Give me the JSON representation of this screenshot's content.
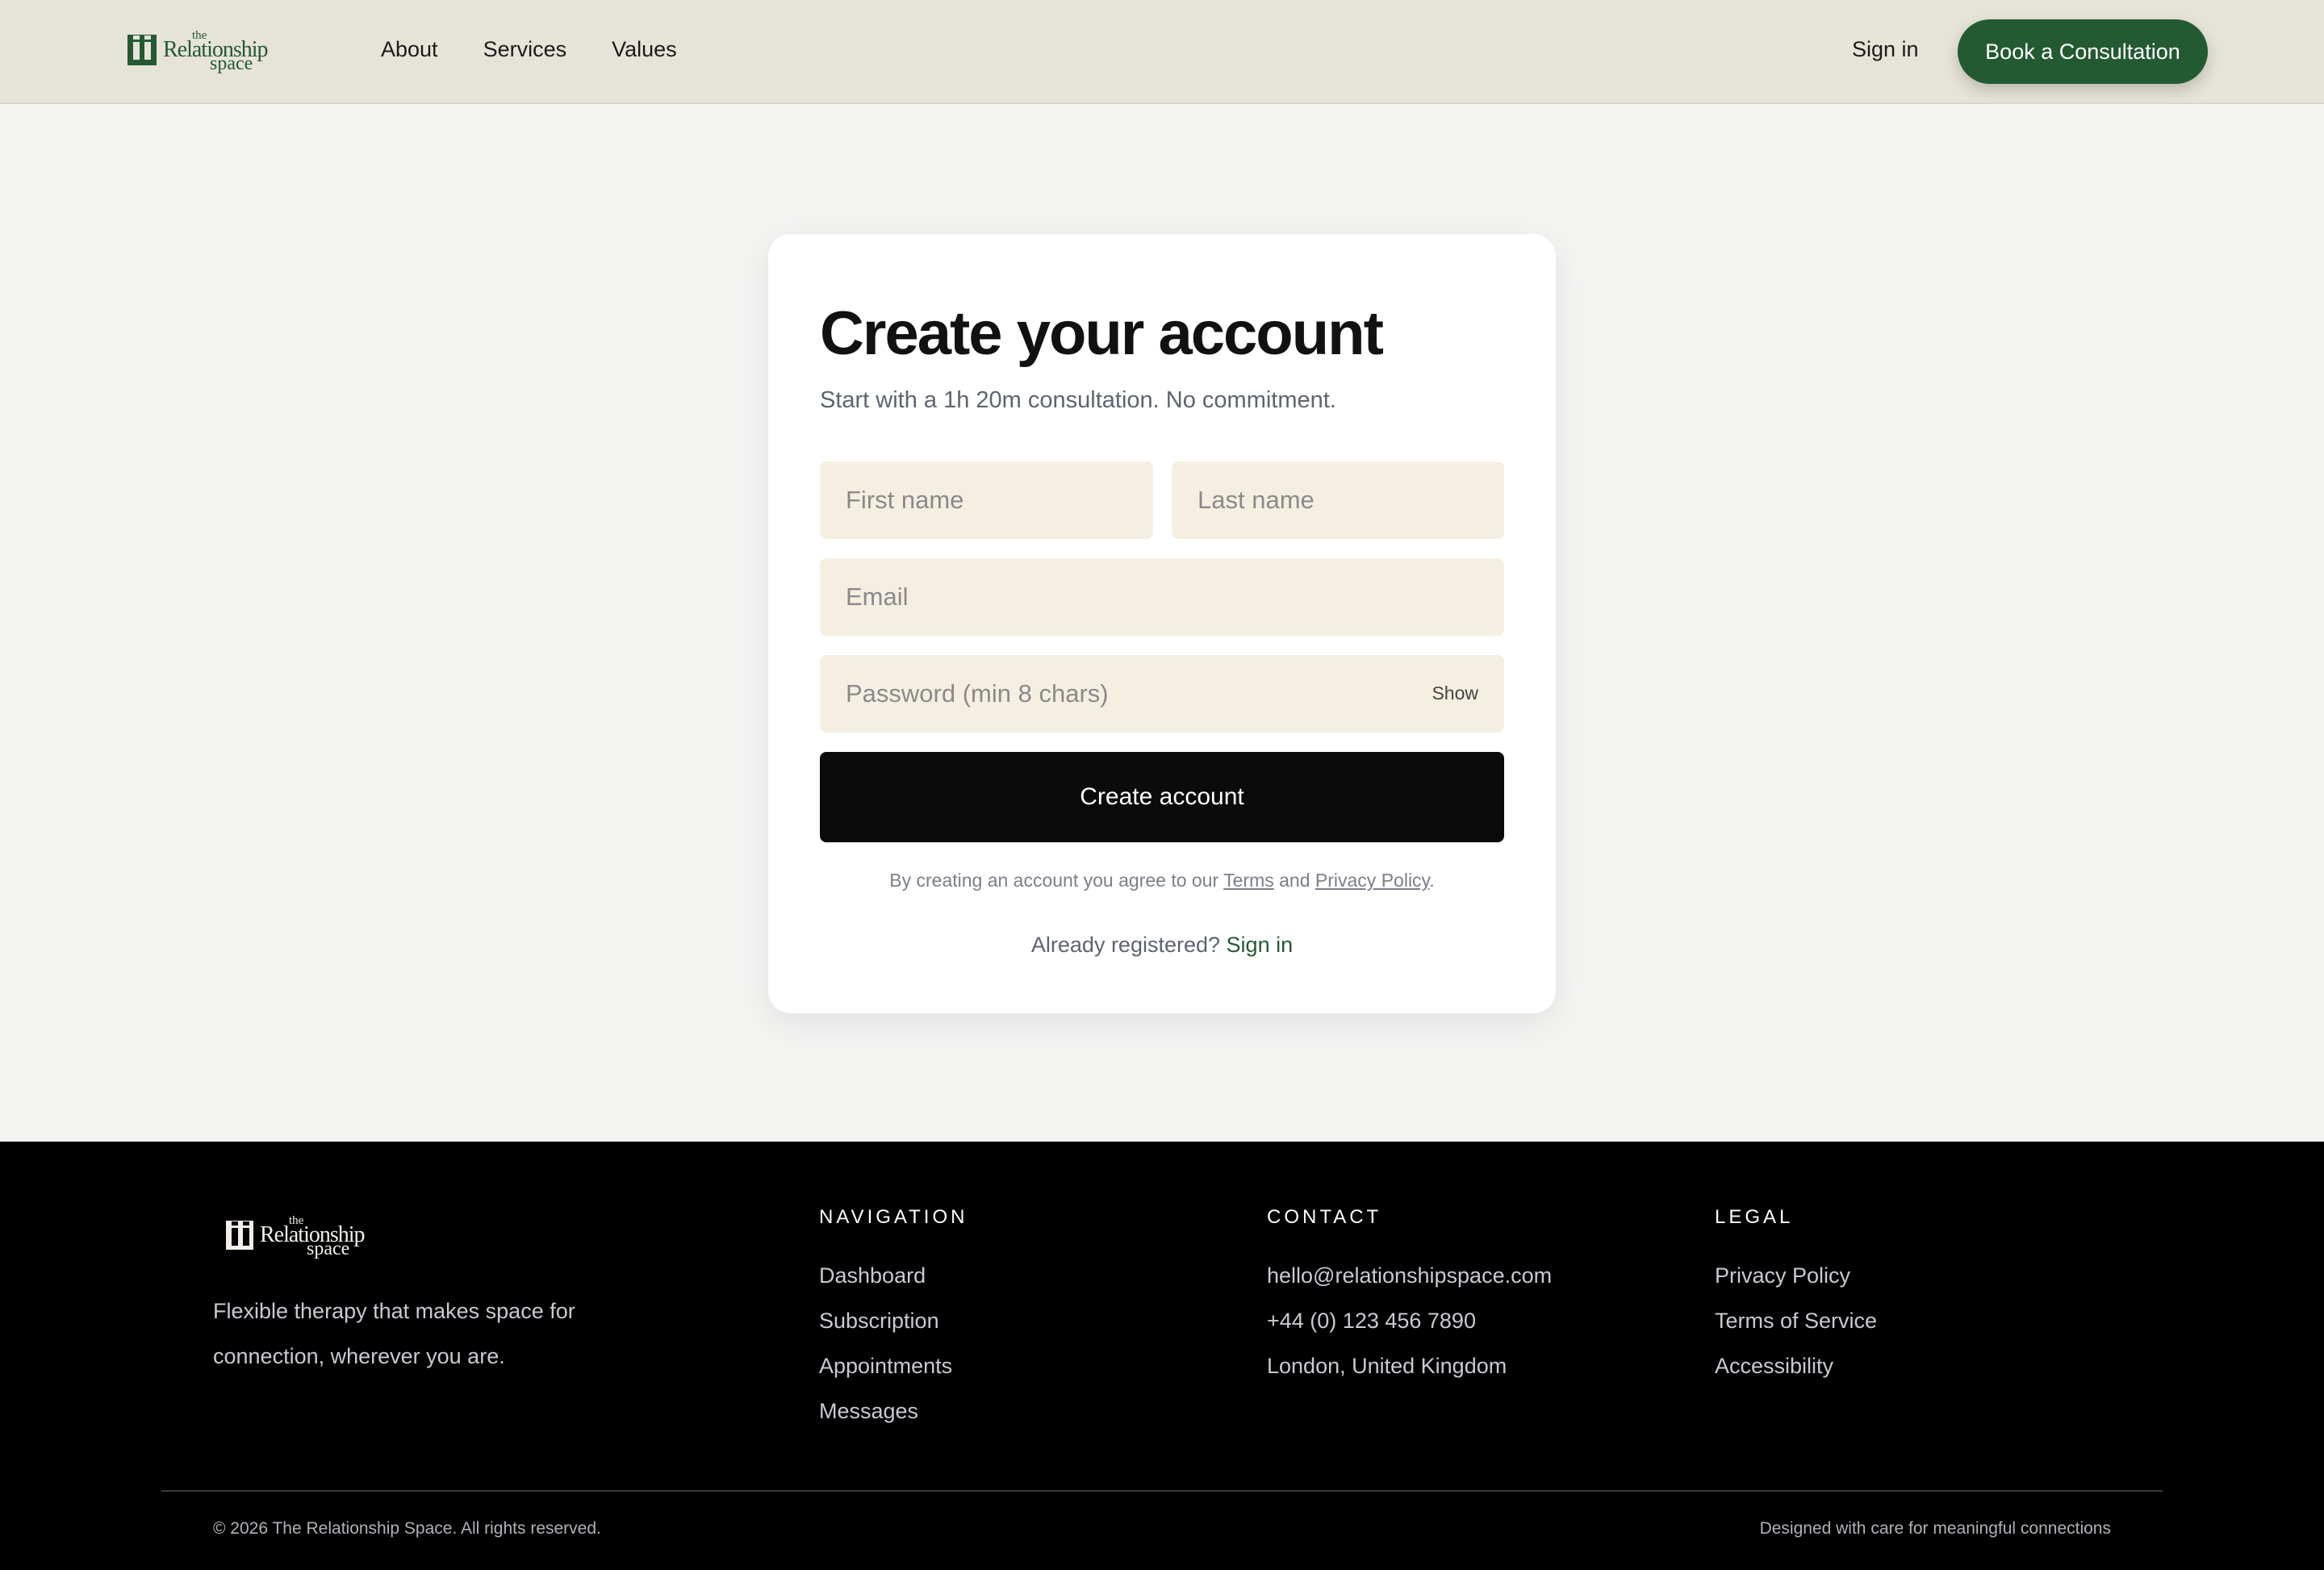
{
  "header": {
    "logo": {
      "line1": "the",
      "line2": "Relationship",
      "line3": "space"
    },
    "nav": [
      "About",
      "Services",
      "Values"
    ],
    "sign_in": "Sign in",
    "cta": "Book a Consultation"
  },
  "form": {
    "title": "Create your account",
    "subtitle": "Start with a 1h 20m consultation. No commitment.",
    "first_name_placeholder": "First name",
    "last_name_placeholder": "Last name",
    "email_placeholder": "Email",
    "password_placeholder": "Password (min 8 chars)",
    "show_label": "Show",
    "submit": "Create account",
    "terms_prefix": "By creating an account you agree to our",
    "terms_link": "Terms",
    "terms_and": "and",
    "privacy_link": "Privacy Policy",
    "terms_suffix": ".",
    "already_text": "Already registered?",
    "sign_in_link": "Sign in"
  },
  "footer": {
    "logo": {
      "line1": "the",
      "line2": "Relationship",
      "line3": "space"
    },
    "tagline": "Flexible therapy that makes space for connection, wherever you are.",
    "navigation": {
      "heading": "NAVIGATION",
      "links": [
        "Dashboard",
        "Subscription",
        "Appointments",
        "Messages"
      ]
    },
    "contact": {
      "heading": "CONTACT",
      "links": [
        "hello@relationshipspace.com",
        "+44 (0) 123 456 7890",
        "London, United Kingdom"
      ]
    },
    "legal": {
      "heading": "LEGAL",
      "links": [
        "Privacy Policy",
        "Terms of Service",
        "Accessibility"
      ]
    },
    "copyright": "© 2026 The Relationship Space. All rights reserved.",
    "designed": "Designed with care for meaningful connections"
  },
  "colors": {
    "brand": "#245a32",
    "header_bg": "#e6e3d8",
    "field_bg": "#f5efe2",
    "button": "#0b0b0b",
    "footer_bg": "#000000"
  }
}
